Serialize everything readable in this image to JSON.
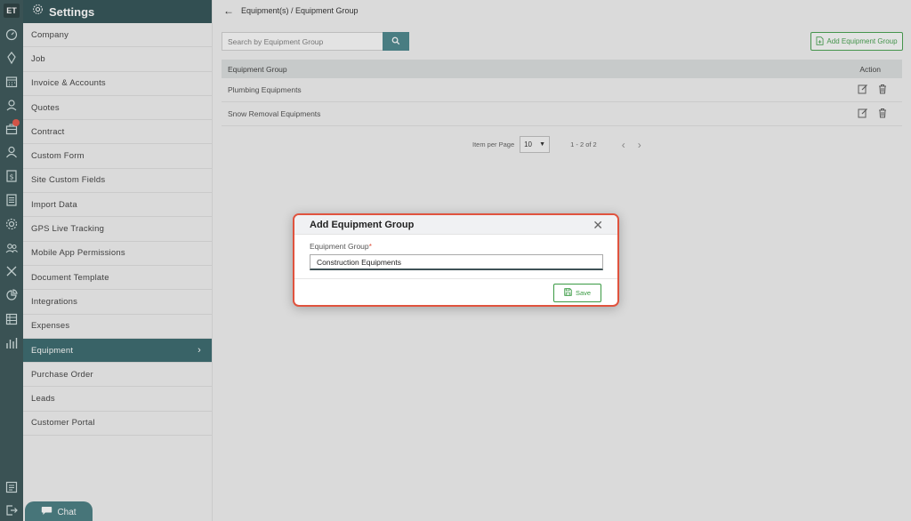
{
  "rail": {
    "logo": "ET",
    "icons": [
      "dashboard-icon",
      "lightbulb-icon",
      "calendar-icon",
      "location-pin-icon",
      "briefcase-icon",
      "user-icon",
      "dollar-doc-icon",
      "document-icon",
      "settings-gear-icon",
      "users-group-icon",
      "tools-icon",
      "chart-pie-icon",
      "spreadsheet-icon",
      "bar-chart-icon",
      "notes-icon",
      "logout-icon"
    ]
  },
  "sidebar": {
    "title": "Settings",
    "items": [
      {
        "label": "Company"
      },
      {
        "label": "Job"
      },
      {
        "label": "Invoice & Accounts"
      },
      {
        "label": "Quotes"
      },
      {
        "label": "Contract"
      },
      {
        "label": "Custom Form"
      },
      {
        "label": "Site Custom Fields"
      },
      {
        "label": "Import Data"
      },
      {
        "label": "GPS Live Tracking"
      },
      {
        "label": "Mobile App Permissions"
      },
      {
        "label": "Document Template"
      },
      {
        "label": "Integrations"
      },
      {
        "label": "Expenses"
      },
      {
        "label": "Equipment"
      },
      {
        "label": "Purchase Order"
      },
      {
        "label": "Leads"
      },
      {
        "label": "Customer Portal"
      }
    ],
    "active_index": 13
  },
  "chat": {
    "label": "Chat"
  },
  "breadcrumb": {
    "text": "Equipment(s) /  Equipment Group"
  },
  "search": {
    "placeholder": "Search by Equipment Group"
  },
  "add_button": {
    "label": "Add Equipment Group"
  },
  "table": {
    "columns": [
      "Equipment Group",
      "Action"
    ],
    "rows": [
      {
        "name": "Plumbing Equipments"
      },
      {
        "name": "Snow Removal Equipments"
      }
    ]
  },
  "pager": {
    "label": "Item per Page",
    "per_page": "10",
    "range": "1 - 2 of 2"
  },
  "modal": {
    "title": "Add Equipment Group",
    "field_label": "Equipment Group",
    "required_mark": "*",
    "field_value": "Construction Equipments",
    "save_label": "Save"
  },
  "colors": {
    "sidebar_header": "#23464a",
    "active_item": "#2b5f63",
    "accent_green": "#3a9a43",
    "modal_border": "#e0533e",
    "search_button": "#3f7e84"
  }
}
